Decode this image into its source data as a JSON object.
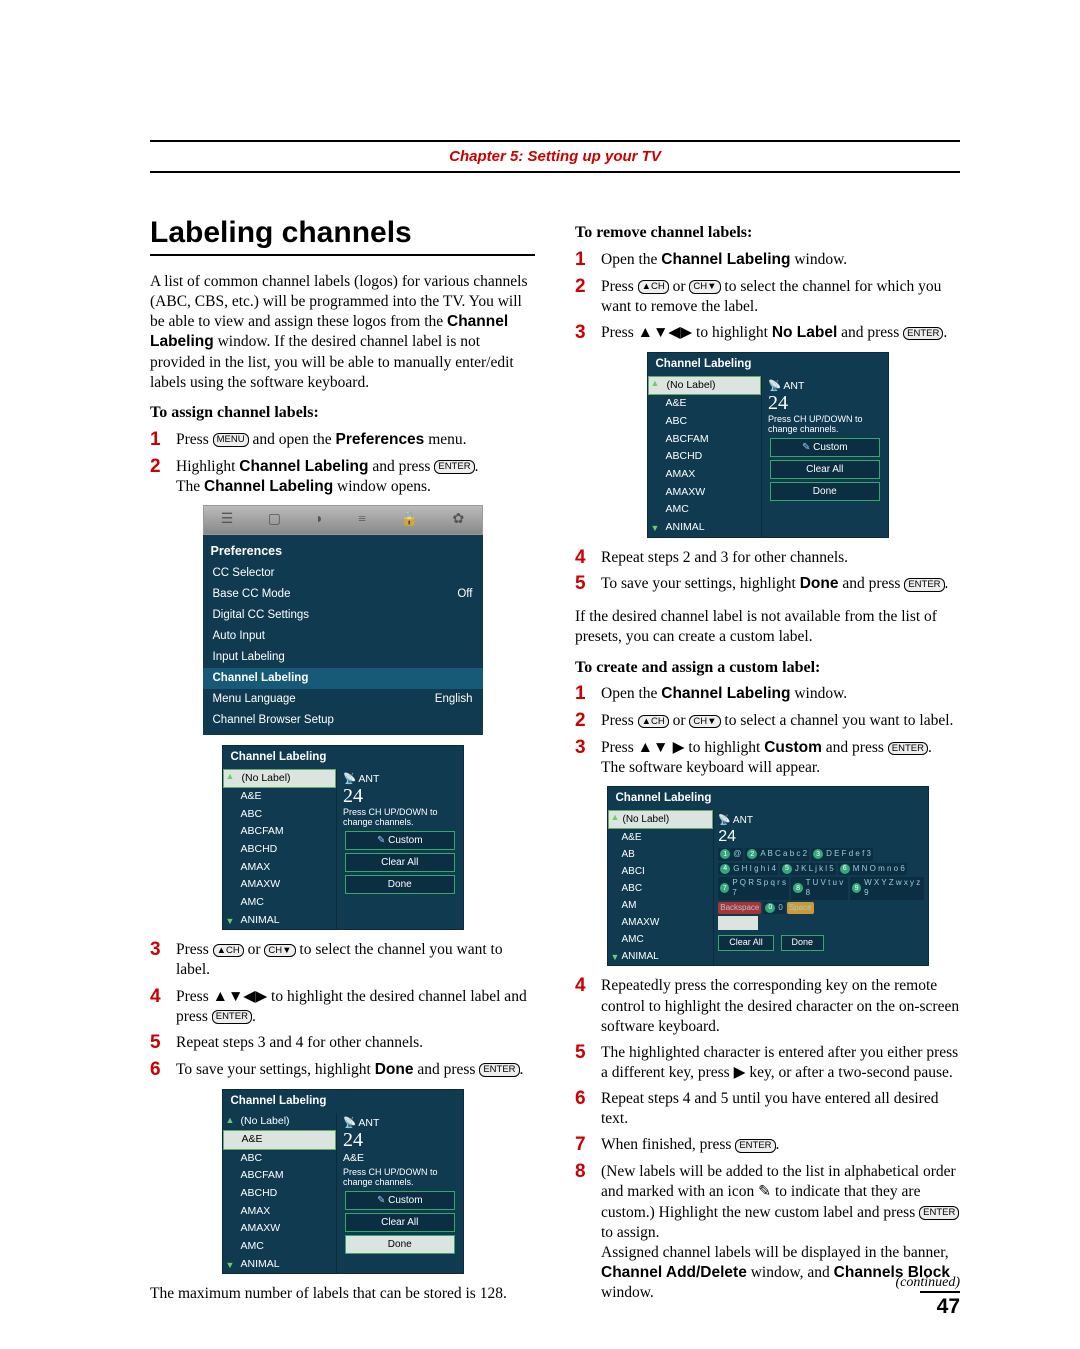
{
  "chapter": "Chapter 5: Setting up your TV",
  "section_title": "Labeling channels",
  "intro": "A list of common channel labels (logos) for various channels (ABC, CBS, etc.) will be programmed into the TV. You will be able to view and assign these logos from the ",
  "intro_bold1": "Channel Labeling",
  "intro2": " window. If the desired channel label is not provided in the list, you will be able to manually enter/edit labels using the software keyboard.",
  "assign_head": "To assign channel labels:",
  "a1a": "Press ",
  "a1_icon": "MENU",
  "a1b": " and open the ",
  "a1_bold": "Preferences",
  "a1c": " menu.",
  "a2a": "Highlight ",
  "a2_bold": "Channel Labeling",
  "a2b": " and press ",
  "a2_icon": "ENTER",
  "a2c": ".",
  "a2_line2a": "The ",
  "a2_line2_bold": "Channel Labeling",
  "a2_line2b": " window opens.",
  "prefs_title": "Preferences",
  "prefs": {
    "r1": "CC Selector",
    "r2": "Base CC Mode",
    "r2v": "Off",
    "r3": "Digital CC Settings",
    "r4": "Auto Input",
    "r5": "Input Labeling",
    "r6": "Channel Labeling",
    "r7": "Menu Language",
    "r7v": "English",
    "r8": "Channel Browser Setup"
  },
  "cl_title": "Channel Labeling",
  "cl_items": [
    "(No Label)",
    "A&E",
    "ABC",
    "ABCFAM",
    "ABCHD",
    "AMAX",
    "AMAXW",
    "AMC",
    "ANIMAL"
  ],
  "cl_ant": "ANT",
  "cl_num": "24",
  "cl_hint": "Press CH UP/DOWN to change channels.",
  "cl_custom": "Custom",
  "cl_clear": "Clear All",
  "cl_done": "Done",
  "cl_aae": "A&E",
  "a3a": "Press ",
  "a3b": " or ",
  "a3c": " to select the channel you want to label.",
  "a4a": "Press ",
  "a4_arrows": "▲▼◀▶",
  "a4b": " to highlight the desired channel label and press ",
  "a4_icon": "ENTER",
  "a4c": ".",
  "a5": "Repeat steps 3 and 4 for other channels.",
  "a6a": "To save your settings, highlight ",
  "a6_bold": "Done",
  "a6b": " and press ",
  "a6_icon": "ENTER",
  "a6c": ".",
  "max_note": "The maximum number of labels that can be stored is 128.",
  "remove_head": "To remove channel labels:",
  "r1a": "Open the ",
  "r1_bold": "Channel Labeling",
  "r1b": " window.",
  "r2a": "Press ",
  "r2b": " or ",
  "r2c": " to select the channel for which you want to remove the label.",
  "r3a": "Press ",
  "r3_arrows": "▲▼◀▶",
  "r3b": " to highlight ",
  "r3_bold": "No Label",
  "r3c": " and press ",
  "r3_icon": "ENTER",
  "r3d": ".",
  "r4": "Repeat steps 2 and 3 for other channels.",
  "r5a": "To save your settings, highlight ",
  "r5_bold": "Done",
  "r5b": " and press ",
  "r5_icon": "ENTER",
  "r5c": ".",
  "preset_note": "If the desired channel label is not available from the list of presets, you can create a custom label.",
  "custom_head": "To create and assign a custom label:",
  "c1a": "Open the ",
  "c1_bold": "Channel Labeling",
  "c1b": " window.",
  "c2a": "Press ",
  "c2b": " or ",
  "c2c": " to select a channel you want to label.",
  "c3a": "Press ",
  "c3_arrows": "▲▼ ▶",
  "c3b": " to highlight ",
  "c3_bold": "Custom",
  "c3c": " and press ",
  "c3_icon": "ENTER",
  "c3d": ".",
  "c3_line2": "The software keyboard will appear.",
  "kb_left": [
    "(No Label)",
    "A&E",
    "AB",
    "ABCI",
    "ABC",
    "AM",
    "AMAXW",
    "AMC",
    "ANIMAL"
  ],
  "kb_keys": [
    {
      "n": "1",
      "t": "@"
    },
    {
      "n": "2",
      "t": "A B C a b c 2"
    },
    {
      "n": "3",
      "t": "D E F d e f 3"
    },
    {
      "n": "4",
      "t": "G H I g h i 4"
    },
    {
      "n": "5",
      "t": "J K L j k l 5"
    },
    {
      "n": "6",
      "t": "M N O m n o 6"
    },
    {
      "n": "7",
      "t": "P Q R S p q r s 7"
    },
    {
      "n": "8",
      "t": "T U V t u v 8"
    },
    {
      "n": "9",
      "t": "W X Y Z w x y z 9"
    },
    {
      "n": "",
      "t": "Backspace"
    },
    {
      "n": "0",
      "t": "0"
    },
    {
      "n": "",
      "t": "Space"
    }
  ],
  "c4": "Repeatedly press the corresponding key on the remote control to highlight the desired character on the on-screen software keyboard.",
  "c5a": "The highlighted character is entered after you either press a different key, press ",
  "c5_arrow": "▶",
  "c5b": " key, or after a two-second pause.",
  "c6": "Repeat steps 4 and 5 until you have entered all desired text.",
  "c7a": "When finished, press ",
  "c7_icon": "ENTER",
  "c7b": ".",
  "c8a": "(New labels will be added to the list in alphabetical order and marked with an icon ",
  "c8_icon": "✎",
  "c8b": " to indicate that they are custom.) Highlight the new custom label and press ",
  "c8_icon2": "ENTER",
  "c8c": " to assign.",
  "c8_line2a": "Assigned channel labels will be displayed in the banner, ",
  "c8_bold1": "Channel Add/Delete",
  "c8_line2b": " window, and ",
  "c8_bold2": "Channels Block",
  "c8_line2c": " window.",
  "continued": "(continued)",
  "pagenum": "47",
  "ch_icons": {
    "up": "▲",
    "dn": "▼",
    "ch": "CH"
  }
}
